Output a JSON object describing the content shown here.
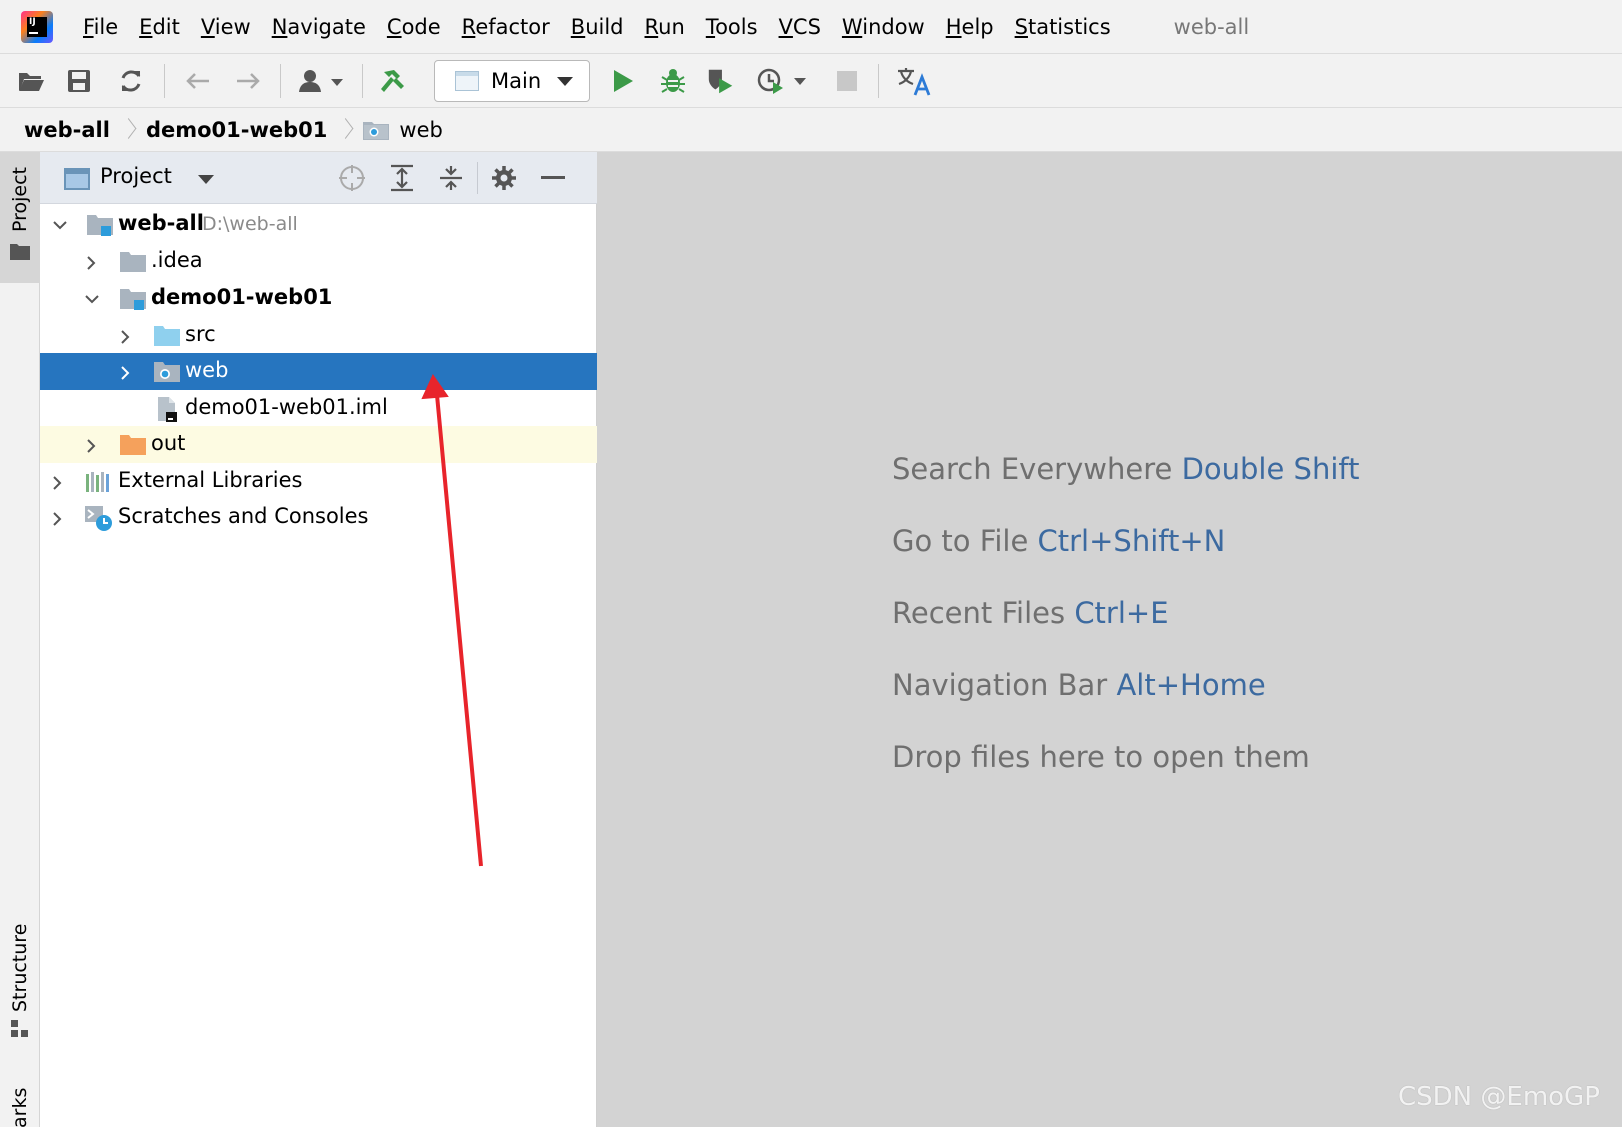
{
  "menu": {
    "items": [
      {
        "label": "File"
      },
      {
        "label": "Edit"
      },
      {
        "label": "View"
      },
      {
        "label": "Navigate"
      },
      {
        "label": "Code"
      },
      {
        "label": "Refactor"
      },
      {
        "label": "Build"
      },
      {
        "label": "Run"
      },
      {
        "label": "Tools"
      },
      {
        "label": "VCS"
      },
      {
        "label": "Window"
      },
      {
        "label": "Help"
      },
      {
        "label": "Statistics"
      }
    ],
    "project_title": "web-all"
  },
  "toolbar": {
    "run_config": "Main",
    "icons": [
      "open-icon",
      "save-icon",
      "sync-icon",
      "back-icon",
      "forward-icon",
      "vcs-user-icon",
      "build-hammer-icon",
      "run-icon",
      "debug-icon",
      "coverage-icon",
      "profile-icon",
      "stop-icon",
      "translate-icon"
    ],
    "colors": {
      "run": "#3c9a48",
      "debug": "#3c9a48",
      "build": "#3c9a48"
    }
  },
  "breadcrumb": {
    "items": [
      "web-all",
      "demo01-web01",
      "web"
    ]
  },
  "left_strip": {
    "project": "Project",
    "structure": "Structure",
    "bookmarks": "arks"
  },
  "project_panel": {
    "title": "Project",
    "tree": {
      "root": {
        "label": "web-all",
        "path": "D:\\web-all"
      },
      "idea": {
        "label": ".idea"
      },
      "module": {
        "label": "demo01-web01"
      },
      "src": {
        "label": "src"
      },
      "web": {
        "label": "web"
      },
      "iml": {
        "label": "demo01-web01.iml"
      },
      "out": {
        "label": "out"
      },
      "libs": {
        "label": "External Libraries"
      },
      "scratches": {
        "label": "Scratches and Consoles"
      }
    },
    "selection_color": "#2675bf",
    "excluded_color": "#fdfbe2"
  },
  "editor": {
    "hints": [
      {
        "text": "Search Everywhere",
        "key": "Double Shift"
      },
      {
        "text": "Go to File",
        "key": "Ctrl+Shift+N"
      },
      {
        "text": "Recent Files",
        "key": "Ctrl+E"
      },
      {
        "text": "Navigation Bar",
        "key": "Alt+Home"
      },
      {
        "text": "Drop files here to open them",
        "key": ""
      }
    ],
    "background": "#d3d3d3",
    "key_color": "#3c6aa0"
  },
  "annotation": {
    "color": "#e8242b"
  },
  "watermark": "CSDN @EmoGP"
}
